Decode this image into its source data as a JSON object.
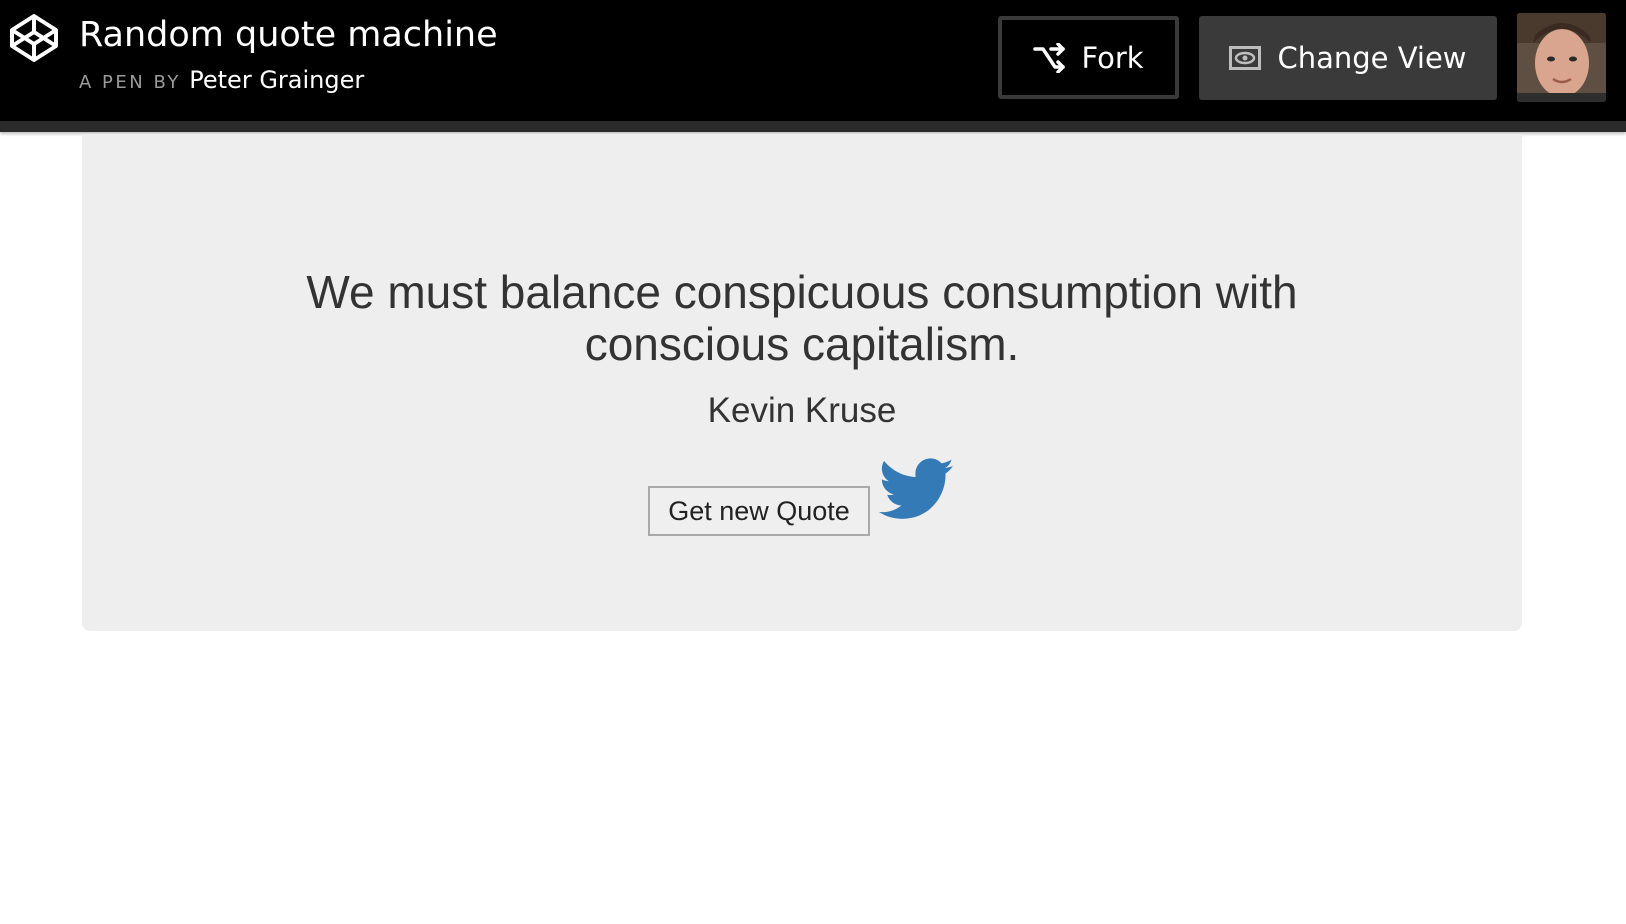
{
  "header": {
    "title": "Random quote machine",
    "by_prefix": "A PEN BY",
    "author": "Peter Grainger",
    "fork_label": "Fork",
    "change_view_label": "Change View",
    "icons": {
      "logo": "codepen-logo-icon",
      "fork": "fork-icon",
      "change_view": "eye-icon"
    }
  },
  "quote": {
    "text": "We must balance conspicuous consumption with conscious capitalism.",
    "author": "Kevin Kruse",
    "new_quote_label": "Get new Quote",
    "share_icon": "twitter-icon"
  },
  "colors": {
    "header_bg": "#000000",
    "card_bg": "#eeeeee",
    "text": "#333333",
    "twitter_blue": "#337ab7"
  }
}
